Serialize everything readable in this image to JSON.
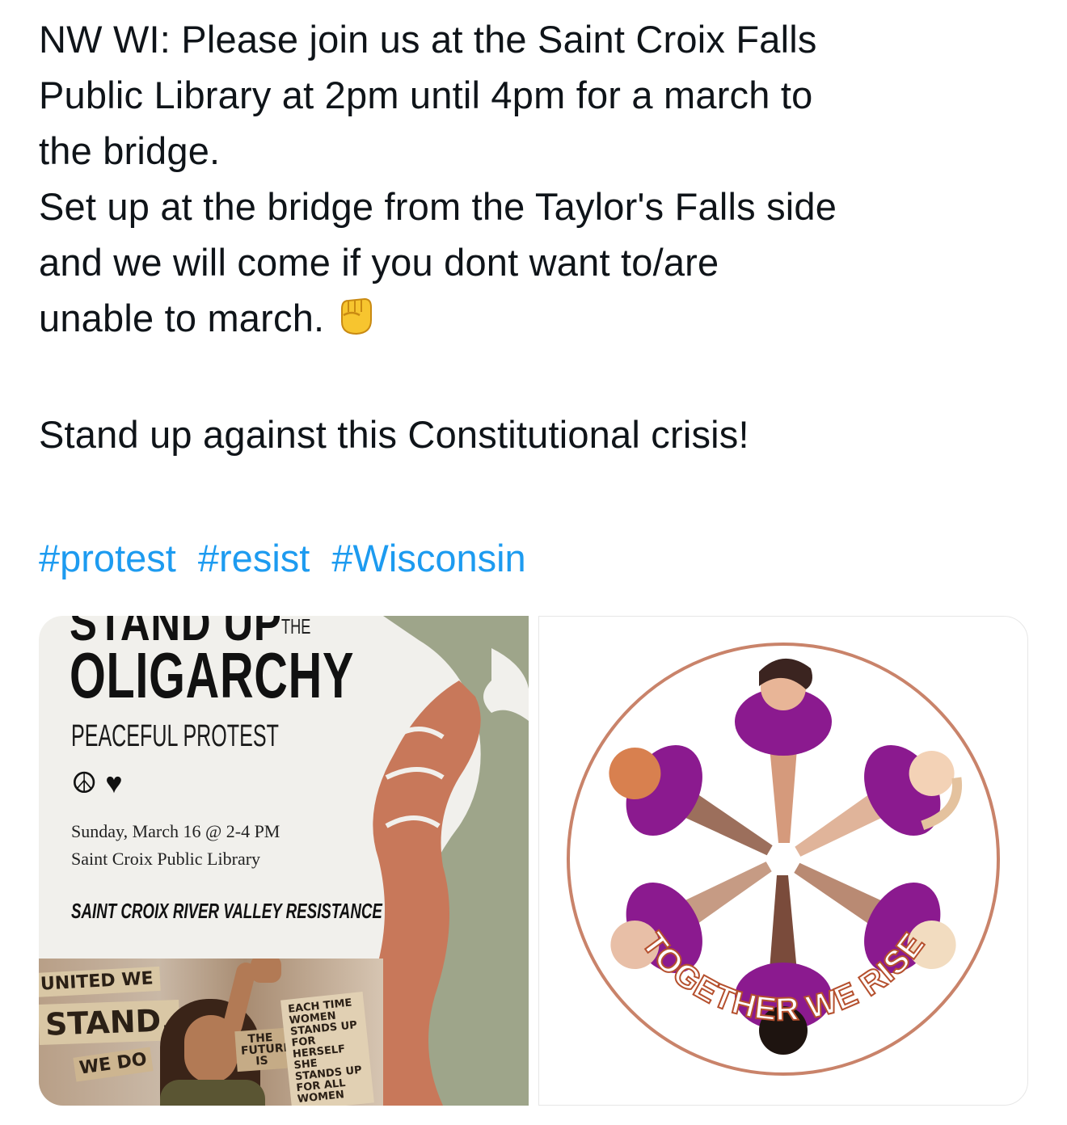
{
  "post": {
    "lines": [
      "NW WI: Please join us at the Saint Croix Falls",
      "Public Library at 2pm until 4pm for a march to",
      "the bridge.",
      "Set up at the bridge from the Taylor's Falls side",
      "and we will come if you dont want to/are",
      "unable to march."
    ],
    "fist_emoji": "raised-fist-icon",
    "call_to_action": "Stand up against this Constitutional crisis!",
    "hashtags": [
      "#protest",
      "#resist",
      "#Wisconsin"
    ]
  },
  "poster": {
    "headline_top": "STAND UP",
    "headline_the": "THE",
    "headline_main": "OLIGARCHY",
    "subtitle": "PEACEFUL PROTEST",
    "symbols": "☮ ♥",
    "date_line": "Sunday, March 16 @ 2-4 PM",
    "location_line": "Saint Croix Public Library",
    "organizer": "SAINT CROIX RIVER VALLEY RESISTANCE",
    "photo_signs": {
      "unite": "UNITED WE",
      "stand": "STAND.",
      "we": "WE DO",
      "future": "THE FUTURE IS",
      "each": "EACH TIME WOMEN STANDS UP FOR HERSELF SHE STANDS UP FOR ALL WOMEN"
    },
    "colors": {
      "terracotta": "#c8785a",
      "sage": "#9ea58a",
      "background": "#f1f0ec"
    }
  },
  "logo": {
    "text": "TOGETHER WE RISE",
    "colors": {
      "ring": "#c9836a",
      "shirt": "#8b1a8f",
      "text": "#b5502e"
    }
  }
}
